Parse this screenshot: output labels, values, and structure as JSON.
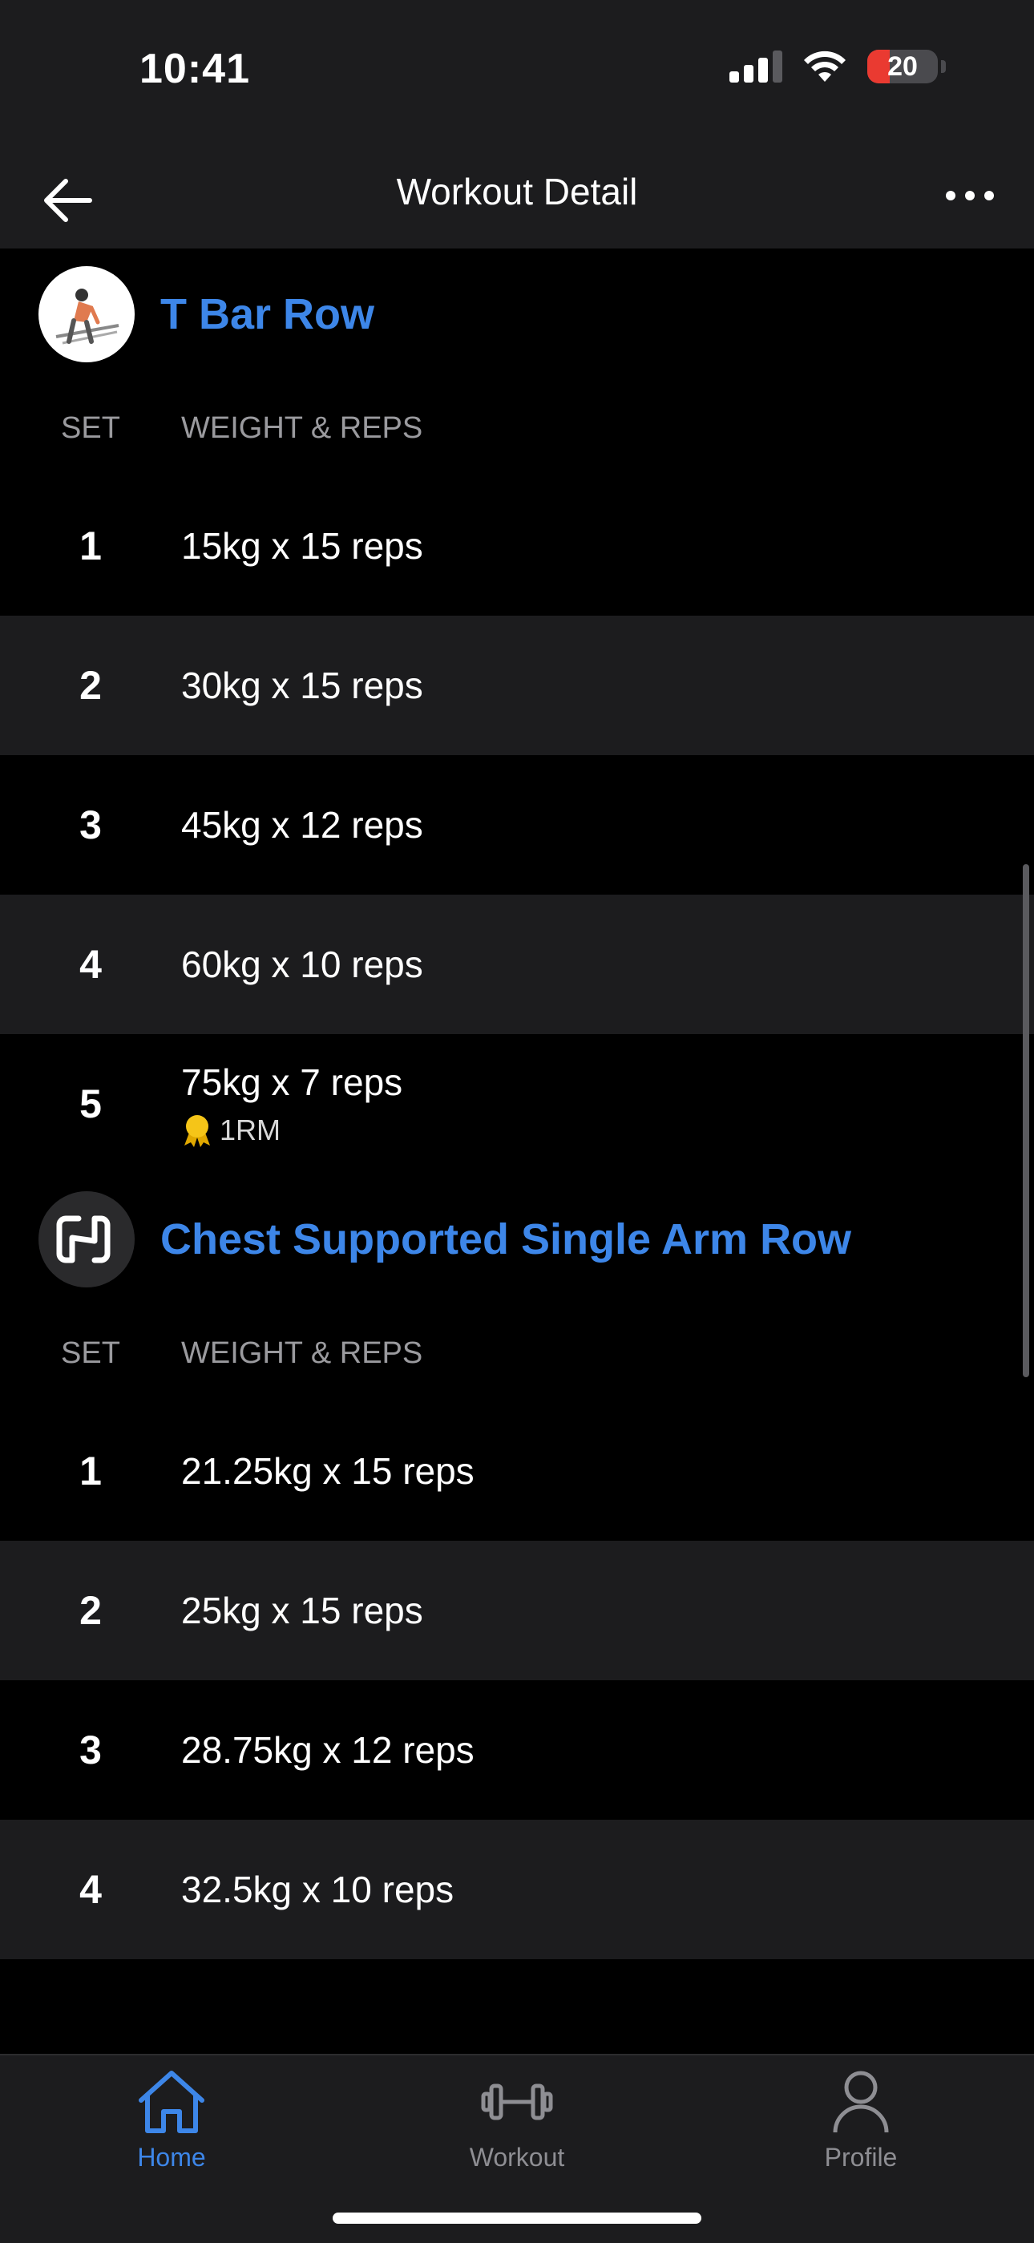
{
  "status_bar": {
    "time": "10:41",
    "battery": "20"
  },
  "nav": {
    "title": "Workout Detail"
  },
  "column_headers": {
    "set": "SET",
    "weight_reps": "WEIGHT & REPS"
  },
  "exercises": [
    {
      "name": "T Bar Row",
      "sets": [
        {
          "num": "1",
          "value": "15kg x 15 reps"
        },
        {
          "num": "2",
          "value": "30kg x 15 reps"
        },
        {
          "num": "3",
          "value": "45kg x 12 reps"
        },
        {
          "num": "4",
          "value": "60kg x 10 reps"
        },
        {
          "num": "5",
          "value": "75kg x 7 reps",
          "badge": "1RM"
        }
      ]
    },
    {
      "name": "Chest Supported Single Arm Row",
      "sets": [
        {
          "num": "1",
          "value": "21.25kg x 15 reps"
        },
        {
          "num": "2",
          "value": "25kg x 15 reps"
        },
        {
          "num": "3",
          "value": "28.75kg x 12 reps"
        },
        {
          "num": "4",
          "value": "32.5kg x 10 reps"
        }
      ]
    }
  ],
  "tabs": [
    {
      "label": "Home",
      "icon": "home-icon",
      "active": true
    },
    {
      "label": "Workout",
      "icon": "dumbbell-icon",
      "active": false
    },
    {
      "label": "Profile",
      "icon": "person-icon",
      "active": false
    }
  ],
  "colors": {
    "accent": "#3d86e8",
    "background": "#000000",
    "surface": "#1c1c1e",
    "battery_low": "#ea3a31"
  }
}
